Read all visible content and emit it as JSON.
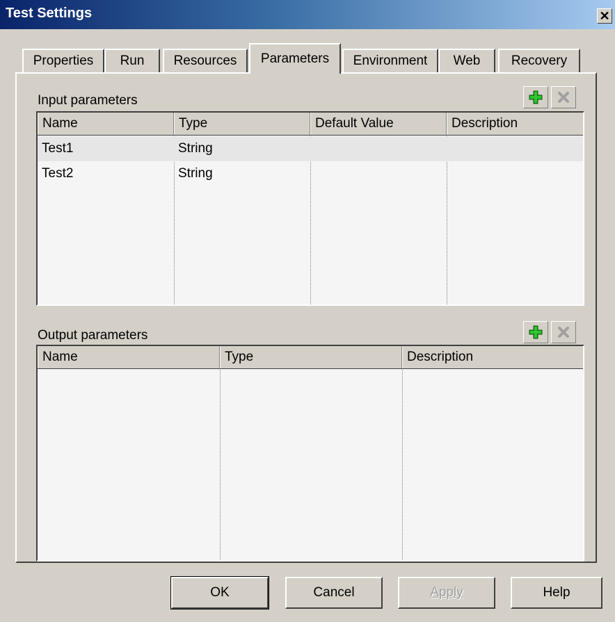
{
  "window": {
    "title": "Test Settings",
    "close_glyph": "✕"
  },
  "tabs": [
    {
      "label": "Properties",
      "active": false
    },
    {
      "label": "Run",
      "active": false
    },
    {
      "label": "Resources",
      "active": false
    },
    {
      "label": "Parameters",
      "active": true
    },
    {
      "label": "Environment",
      "active": false
    },
    {
      "label": "Web",
      "active": false
    },
    {
      "label": "Recovery",
      "active": false
    }
  ],
  "input_parameters": {
    "label": "Input parameters",
    "columns": [
      "Name",
      "Type",
      "Default Value",
      "Description"
    ],
    "rows": [
      {
        "name": "Test1",
        "type": "String",
        "default_value": "",
        "description": "",
        "selected": true
      },
      {
        "name": "Test2",
        "type": "String",
        "default_value": "",
        "description": "",
        "selected": false
      }
    ],
    "add_icon": "plus-icon",
    "remove_icon": "x-icon"
  },
  "output_parameters": {
    "label": "Output parameters",
    "columns": [
      "Name",
      "Type",
      "Description"
    ],
    "rows": [],
    "add_icon": "plus-icon",
    "remove_icon": "x-icon"
  },
  "buttons": {
    "ok": "OK",
    "cancel": "Cancel",
    "apply": "Apply",
    "help": "Help"
  },
  "colors": {
    "plus_green": "#1a9a1a",
    "disabled_gray": "#a0a0a0",
    "title_dark": "#0a246a",
    "title_light": "#a6caf0"
  }
}
